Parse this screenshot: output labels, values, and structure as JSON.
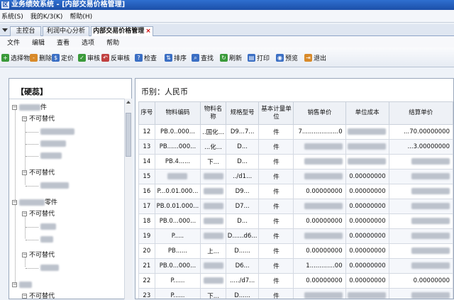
{
  "window": {
    "title": "业务绩效系统 - [内部交易价格管理]",
    "logo_glyph": "区"
  },
  "system_menu": [
    {
      "label": "系统(S)"
    },
    {
      "label": "我的K/3(K)"
    },
    {
      "label": "帮助(H)"
    }
  ],
  "tabs": [
    {
      "label": "主控台"
    },
    {
      "label": "利润中心分析"
    },
    {
      "label": "内部交易价格管理",
      "close": "×"
    }
  ],
  "menu": [
    {
      "label": "文件"
    },
    {
      "label": "编辑"
    },
    {
      "label": "查看"
    },
    {
      "label": "选项"
    },
    {
      "label": "帮助"
    }
  ],
  "toolbar": [
    {
      "label": "选择物料",
      "icon": "select-material-icon",
      "color": "#3a9a3a",
      "glyph": "+"
    },
    {
      "label": "删除",
      "icon": "delete-icon",
      "color": "#d88a2a",
      "glyph": "-"
    },
    {
      "label": "定价",
      "icon": "price-icon",
      "color": "#3b6fc4",
      "glyph": "$"
    },
    {
      "label": "审核",
      "icon": "approve-icon",
      "color": "#3a9a3a",
      "glyph": "✓"
    },
    {
      "label": "反审核",
      "icon": "unapprove-icon",
      "color": "#c04040",
      "glyph": "↶"
    },
    {
      "label": "检查",
      "icon": "check-icon",
      "color": "#3b6fc4",
      "glyph": "?"
    },
    {
      "label": "排序",
      "icon": "sort-icon",
      "color": "#3b6fc4",
      "glyph": "⇅"
    },
    {
      "label": "查找",
      "icon": "find-icon",
      "color": "#3b6fc4",
      "glyph": "⌕"
    },
    {
      "label": "刷新",
      "icon": "refresh-icon",
      "color": "#3a9a3a",
      "glyph": "↻"
    },
    {
      "label": "打印",
      "icon": "print-icon",
      "color": "#3b6fc4",
      "glyph": "▤"
    },
    {
      "label": "预览",
      "icon": "preview-icon",
      "color": "#3b6fc4",
      "glyph": "◉"
    },
    {
      "label": "退出",
      "icon": "exit-icon",
      "color": "#d88a2a",
      "glyph": "⇥"
    }
  ],
  "left_panel": {
    "title": "【硬蕊】",
    "tree": [
      {
        "label": "件",
        "box": "−"
      },
      {
        "label": "不可替代",
        "box": "−"
      },
      {
        "label": ""
      },
      {
        "label": ""
      },
      {
        "label": ""
      },
      {
        "label": "不可替代",
        "box": "−"
      },
      {
        "label": ""
      },
      {
        "label": "零件",
        "box": "−"
      },
      {
        "label": "不可替代",
        "box": "−"
      },
      {
        "label": ""
      },
      {
        "label": ""
      },
      {
        "label": "不可替代",
        "box": "−"
      },
      {
        "label": ""
      },
      {
        "label": "",
        "box": "−"
      },
      {
        "label": "不可替代",
        "box": "−"
      }
    ]
  },
  "right_panel": {
    "currency_label": "币别：人民币",
    "columns": [
      "序号",
      "物料编码",
      "物料名称",
      "规格型号",
      "基本计量单位",
      "销售单价",
      "单位成本",
      "结算单价"
    ],
    "rows": [
      {
        "seq": "12",
        "code": "PB.0..000...",
        "name": "..国化...",
        "spec": "D9...7...",
        "unit": "件",
        "sale": "7...................0",
        "cost": "",
        "settle": "...70.00000000"
      },
      {
        "seq": "13",
        "code": "PB......000...",
        "name": "...化...",
        "spec": "D...",
        "unit": "件",
        "sale": "",
        "cost": "",
        "settle": "...3.00000000"
      },
      {
        "seq": "14",
        "code": "PB.4......",
        "name": "下...",
        "spec": "D...",
        "unit": "件",
        "sale": "",
        "cost": "",
        "settle": ""
      },
      {
        "seq": "15",
        "code": "",
        "name": "",
        "spec": "../d1...",
        "unit": "件",
        "sale": "",
        "cost": "0.00000000",
        "settle": ""
      },
      {
        "seq": "16",
        "code": "P...0.01.000...",
        "name": "",
        "spec": "D9...",
        "unit": "件",
        "sale": "0.00000000",
        "cost": "0.00000000",
        "settle": ""
      },
      {
        "seq": "17",
        "code": "PB.0.01.000...",
        "name": "",
        "spec": "D7...",
        "unit": "件",
        "sale": "",
        "cost": "0.00000000",
        "settle": ""
      },
      {
        "seq": "18",
        "code": "PB.0...000...",
        "name": "",
        "spec": "D...",
        "unit": "件",
        "sale": "0.00000000",
        "cost": "0.00000000",
        "settle": ""
      },
      {
        "seq": "19",
        "code": "P.....",
        "name": "",
        "spec": "D......d6...",
        "unit": "件",
        "sale": "",
        "cost": "0.00000000",
        "settle": ""
      },
      {
        "seq": "20",
        "code": "PB......",
        "name": "上...",
        "spec": "D......",
        "unit": "件",
        "sale": "0.00000000",
        "cost": "0.00000000",
        "settle": ""
      },
      {
        "seq": "21",
        "code": "PB.0...000...",
        "name": "",
        "spec": "D6...",
        "unit": "件",
        "sale": "1.............00",
        "cost": "0.00000000",
        "settle": ""
      },
      {
        "seq": "22",
        "code": "P......",
        "name": "",
        "spec": "...../d7...",
        "unit": "件",
        "sale": "0.00000000",
        "cost": "0.00000000",
        "settle": "0.00000000"
      },
      {
        "seq": "23",
        "code": "P......",
        "name": "下...",
        "spec": "D......",
        "unit": "件",
        "sale": "",
        "cost": "",
        "settle": ""
      }
    ]
  }
}
